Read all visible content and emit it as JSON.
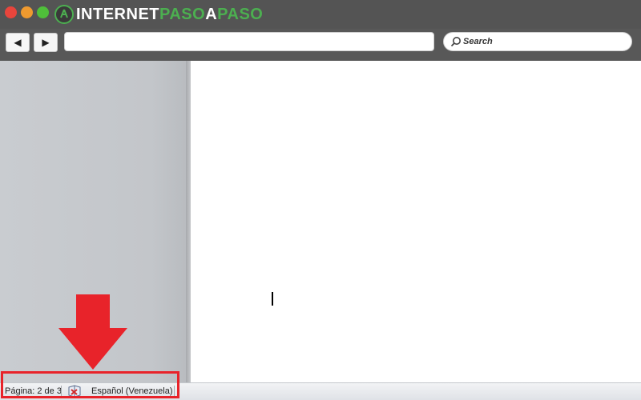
{
  "app": {
    "logo": {
      "part1": "INTERNET",
      "part2": "PASO",
      "part3": "A",
      "part4": "PASO"
    }
  },
  "toolbar": {
    "back_label": "◀",
    "forward_label": "▶",
    "address_value": "",
    "search_label": "Search"
  },
  "status_bar": {
    "page_text": "Página: 2 de 3",
    "language": "Español (Venezuela)"
  },
  "colors": {
    "highlight": "#e8232a",
    "logo_accent": "#4caf50"
  }
}
